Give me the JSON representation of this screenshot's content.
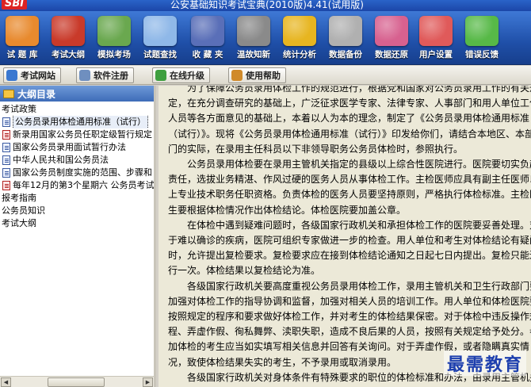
{
  "window": {
    "logo": "SBI",
    "title": "公安基础知识考试宝典(2010版)4.41(试用版)"
  },
  "toolbar": {
    "items": [
      {
        "label": "试 题 库",
        "icon": "book-stack-icon",
        "color": "#e88a2e"
      },
      {
        "label": "考试大纲",
        "icon": "binder-icon",
        "color": "#c93a2a"
      },
      {
        "label": "模拟考场",
        "icon": "clipboard-icon",
        "color": "#6aa84f"
      },
      {
        "label": "试题查找",
        "icon": "magnifier-icon",
        "color": "#8fb8e8"
      },
      {
        "label": "收 藏 夹",
        "icon": "folder-icon",
        "color": "#5a6fb8"
      },
      {
        "label": "温故知新",
        "icon": "scissors-icon",
        "color": "#8a8a8a"
      },
      {
        "label": "统计分析",
        "icon": "pie-chart-icon",
        "color": "#e7b520"
      },
      {
        "label": "数据备份",
        "icon": "disk-icon",
        "color": "#b0b0b0"
      },
      {
        "label": "数据还原",
        "icon": "restore-box-icon",
        "color": "#d7618f"
      },
      {
        "label": "用户设置",
        "icon": "user-settings-icon",
        "color": "#e05a5a"
      },
      {
        "label": "错误反馈",
        "icon": "refresh-arrows-icon",
        "color": "#57b947"
      }
    ]
  },
  "toolbar2": {
    "items": [
      {
        "label": "考试网站",
        "icon": "globe-icon",
        "color": "#3a78d0"
      },
      {
        "label": "软件注册",
        "icon": "register-icon",
        "color": "#6f8fbf"
      },
      {
        "label": "在线升级",
        "icon": "download-icon",
        "color": "#3f9f3f"
      },
      {
        "label": "使用帮助",
        "icon": "help-icon",
        "color": "#d08a2a"
      }
    ]
  },
  "left_panel": {
    "title": "大纲目录",
    "tree": [
      {
        "label": "考试政策",
        "level": 0
      },
      {
        "label": "公务员录用体检通用标准（试行）",
        "level": 1,
        "selected": true,
        "icon": "doc"
      },
      {
        "label": "新录用国家公务员任职定级暂行规定",
        "level": 1,
        "icon": "pdf"
      },
      {
        "label": "国家公务员录用面试暂行办法",
        "level": 1,
        "icon": "doc"
      },
      {
        "label": "中华人民共和国公务员法",
        "level": 1,
        "icon": "doc"
      },
      {
        "label": "国家公务员制度实施的范围、步骤和",
        "level": 1,
        "icon": "doc"
      },
      {
        "label": "每年12月的第3个星期六 公务员考试",
        "level": 1,
        "icon": "pdf"
      },
      {
        "label": "报考指南",
        "level": 0
      },
      {
        "label": "公务员知识",
        "level": 0
      },
      {
        "label": "考试大纲",
        "level": 0
      }
    ]
  },
  "content": {
    "paragraphs": [
      "为了保障公务员录用体检工作的规范进行，根据党和国家对公务员录用工作的有关规定，在充分调查研究的基础上，广泛征求医学专家、法律专家、人事部门和用人单位工作人员等各方面意见的基础上，本着以人为本的理念，制定了《公务员录用体检通用标准（试行）》。现将《公务员录用体检通用标准（试行）》印发给你们，请结合本地区、本部门的实际，在录用主任科员以下非领导职务公务员体检时，参照执行。",
      "公务员录用体检要在录用主管机关指定的县级以上综合性医院进行。医院要切实负起责任，选拔业务精湛、作风过硬的医务人员从事体检工作。主检医师应具有副主任医师以上专业技术职务任职资格。负责体检的医务人员要坚持原则，严格执行体检标准。主检医生要根据体检情况作出体检结论。体检医院要加盖公章。",
      "在体检中遇到疑难问题时，各级国家行政机关和承担体检工作的医院要妥善处理。对于难以确诊的疾病，医院可组织专家做进一步的检查。用人单位和考生对体检结论有疑问时，允许提出复检要求。复检要求应在接到体检结论通知之日起七日内提出。复检只能进行一次。体检结果以复检结论为准。",
      "各级国家行政机关要高度重视公务员录用体检工作，录用主管机关和卫生行政部门要加强对体检工作的指导协调和监督，加强对相关人员的培训工作。用人单位和体检医院要按照规定的程序和要求做好体检工作，并对考生的体检结果保密。对于体检中违反操作规程、弄虚作假、徇私舞弊、渎职失职，造成不良后果的人员，按照有关规定给予处分。参加体检的考生应当如实填写相关信息并回答有关询问。对于弄虚作假，或者隐瞒真实情况，致使体检结果失实的考生，不予录用或取消录用。",
      "各级国家行政机关对身体条件有特殊要求的职位的体检标准和办法，由录用主管机关会同国务院卫生行政部门另行规定或批准。"
    ]
  },
  "watermark": "最需教育"
}
